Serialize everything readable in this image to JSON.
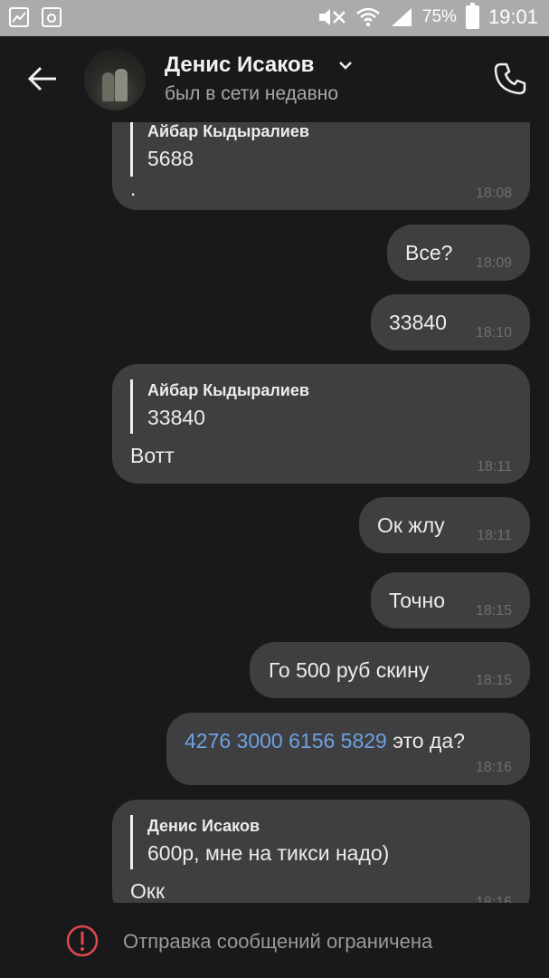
{
  "status_bar": {
    "battery": "75%",
    "time": "19:01"
  },
  "header": {
    "contact_name": "Денис Исаков",
    "contact_status": "был в сети недавно"
  },
  "messages": [
    {
      "side": "in",
      "quote_name": "Айбар Кыдыралиев",
      "quote_text": "5688",
      "text": ".",
      "time": "18:08"
    },
    {
      "side": "out",
      "text": "Все?",
      "time": "18:09"
    },
    {
      "side": "out",
      "text": "33840",
      "time": "18:10"
    },
    {
      "side": "in",
      "quote_name": "Айбар Кыдыралиев",
      "quote_text": "33840",
      "text": "Вотт",
      "time": "18:11"
    },
    {
      "side": "out",
      "text": "Ок жлу",
      "time": "18:11"
    },
    {
      "side": "out",
      "text": "Точно",
      "time": "18:15"
    },
    {
      "side": "out",
      "text": "Го 500 руб скину",
      "time": "18:15"
    },
    {
      "side": "out",
      "link_text": "4276 3000 6156 5829",
      "text": " это да?",
      "time": "18:16"
    },
    {
      "side": "in",
      "quote_name": "Денис Исаков",
      "quote_text": "600р, мне на тикси надо)",
      "text": "Окк",
      "time": "18:16"
    }
  ],
  "bottom": {
    "notice": "Отправка сообщений ограничена"
  },
  "colors": {
    "background": "#19191b",
    "bubble": "#3f3f41",
    "link": "#6ea1e0",
    "warning": "#e0484d",
    "status_bar": "#ababab"
  }
}
